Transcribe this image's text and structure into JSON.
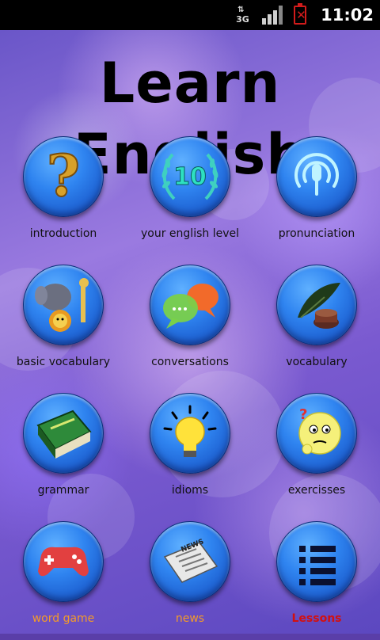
{
  "status_bar": {
    "network": "3G",
    "time": "11:02",
    "icons": [
      "data-arrows-icon",
      "signal-bars-icon",
      "battery-empty-icon"
    ]
  },
  "app": {
    "title": "Learn English",
    "menu": [
      {
        "label": "introduction",
        "icon": "question-mark-icon"
      },
      {
        "label": "your english level",
        "icon": "level-laurel-icon"
      },
      {
        "label": "pronunciation",
        "icon": "podcast-microphone-icon"
      },
      {
        "label": "basic vocabulary",
        "icon": "animals-icon"
      },
      {
        "label": "conversations",
        "icon": "speech-bubbles-icon"
      },
      {
        "label": "vocabulary",
        "icon": "quill-inkwell-icon"
      },
      {
        "label": "grammar",
        "icon": "dictionary-book-icon"
      },
      {
        "label": "idioms",
        "icon": "light-bulb-icon"
      },
      {
        "label": "exercisses",
        "icon": "thinking-face-icon"
      },
      {
        "label": "word game",
        "icon": "gamepad-icon"
      },
      {
        "label": "news",
        "icon": "newspaper-icon"
      },
      {
        "label": "Lessons",
        "icon": "list-icon"
      }
    ],
    "level_badge_text": "10",
    "colors": {
      "button_blue": "#2f84f0",
      "label_orange": "#f39a2a",
      "label_red": "#d21010"
    }
  }
}
